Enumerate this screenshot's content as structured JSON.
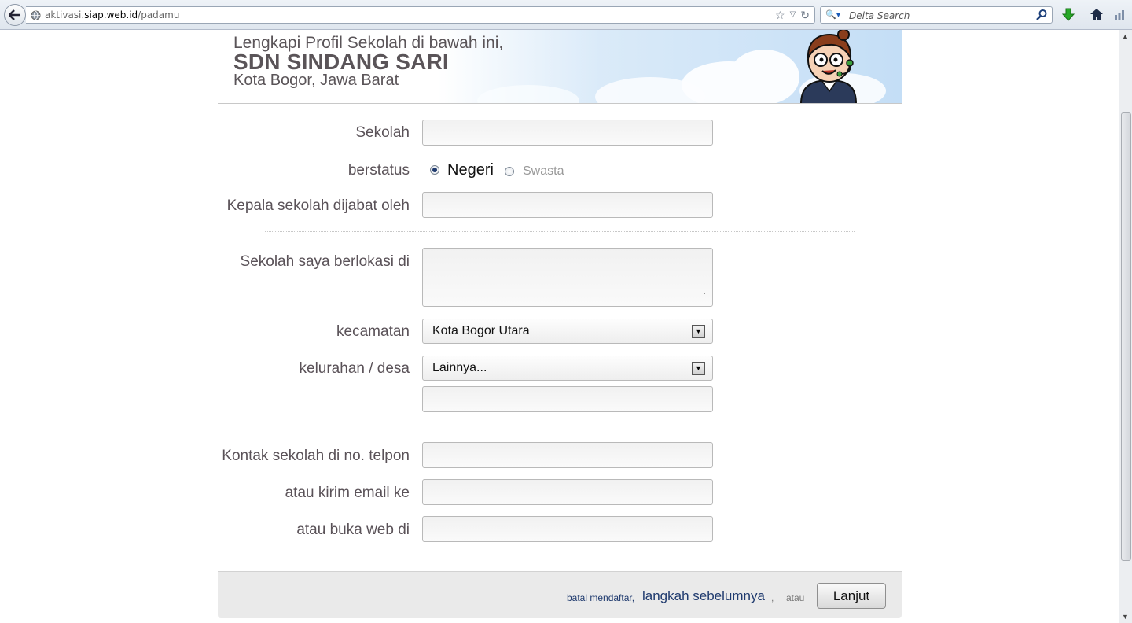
{
  "browser": {
    "url_prefix": "aktivasi.",
    "url_domain": "siap.web.id",
    "url_path": "/padamu",
    "search_placeholder": "Delta Search"
  },
  "header": {
    "intro": "Lengkapi Profil Sekolah di bawah ini,",
    "school_name": "SDN SINDANG SARI",
    "location": "Kota Bogor, Jawa Barat"
  },
  "form": {
    "sekolah_label": "Sekolah",
    "sekolah_value": "",
    "status_label": "berstatus",
    "status_options": [
      "Negeri",
      "Swasta"
    ],
    "status_selected": "Negeri",
    "kepala_label": "Kepala sekolah dijabat oleh",
    "kepala_value": "",
    "lokasi_label": "Sekolah saya berlokasi di",
    "lokasi_value": "",
    "kecamatan_label": "kecamatan",
    "kecamatan_value": "Kota Bogor Utara",
    "kelurahan_label": "kelurahan / desa",
    "kelurahan_value": "Lainnya...",
    "kelurahan_other_value": "",
    "telpon_label": "Kontak sekolah di no. telpon",
    "telpon_value": "",
    "email_label": "atau kirim email ke",
    "email_value": "",
    "web_label": "atau buka web di",
    "web_value": ""
  },
  "footer": {
    "cancel_text": "batal mendaftar,",
    "prev_link": "langkah sebelumnya",
    "comma": ",",
    "or_text": "atau",
    "next_button": "Lanjut"
  }
}
